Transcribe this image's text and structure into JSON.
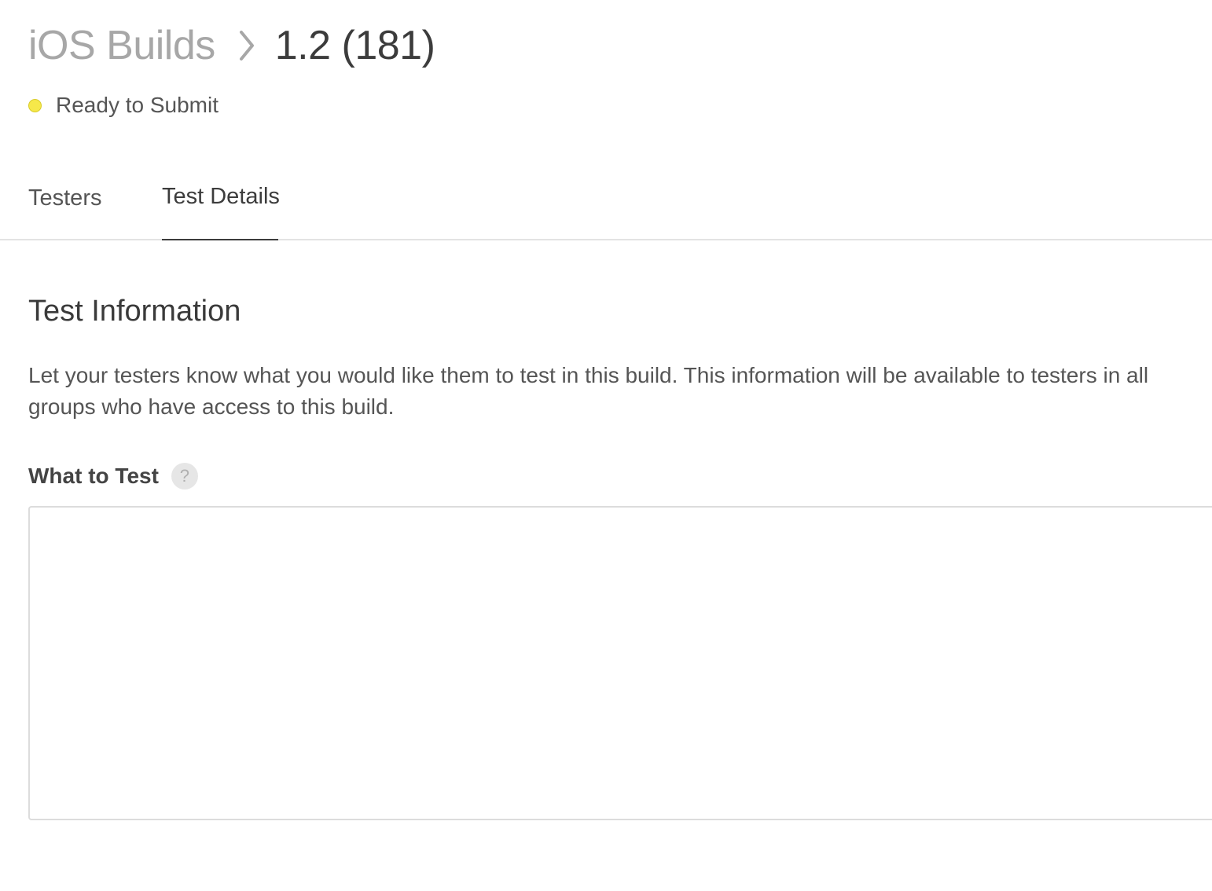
{
  "breadcrumb": {
    "parent": "iOS Builds",
    "separator_icon": "chevron-right-icon",
    "current": "1.2 (181)"
  },
  "status": {
    "label": "Ready to Submit",
    "color": "#f6e84a"
  },
  "tabs": [
    {
      "label": "Testers",
      "active": false
    },
    {
      "label": "Test Details",
      "active": true
    }
  ],
  "section": {
    "title": "Test Information",
    "description": "Let your testers know what you would like them to test in this build. This information will be available to testers in all groups who have access to this build."
  },
  "what_to_test": {
    "label": "What to Test",
    "help_glyph": "?",
    "value": "",
    "placeholder": ""
  }
}
